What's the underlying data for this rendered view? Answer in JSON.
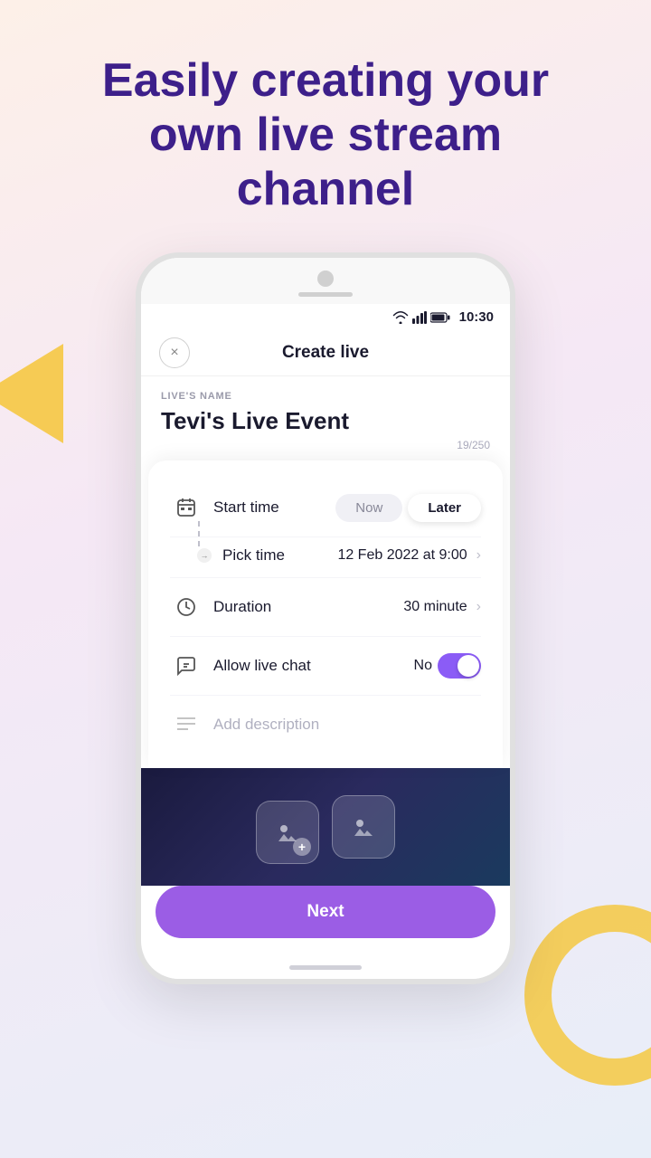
{
  "hero": {
    "title": "Easily creating your own live stream channel"
  },
  "status_bar": {
    "time": "10:30"
  },
  "header": {
    "title": "Create live",
    "close_label": "×"
  },
  "form": {
    "field_label": "LIVE'S NAME",
    "field_value": "Tevi's Live Event",
    "char_count": "19/250"
  },
  "panel": {
    "start_time": {
      "label": "Start time",
      "btn_now": "Now",
      "btn_later": "Later"
    },
    "pick_time": {
      "label": "Pick time",
      "value": "12 Feb 2022 at 9:00"
    },
    "duration": {
      "label": "Duration",
      "value": "30 minute"
    },
    "allow_chat": {
      "label": "Allow live chat",
      "value_label": "No",
      "toggle_state": "on"
    },
    "description": {
      "placeholder": "Add description"
    }
  },
  "next_button": {
    "label": "Next"
  },
  "icons": {
    "close": "×",
    "chevron": "›",
    "calendar": "📅",
    "clock": "🕐",
    "chat": "💬",
    "lines": "≡"
  }
}
